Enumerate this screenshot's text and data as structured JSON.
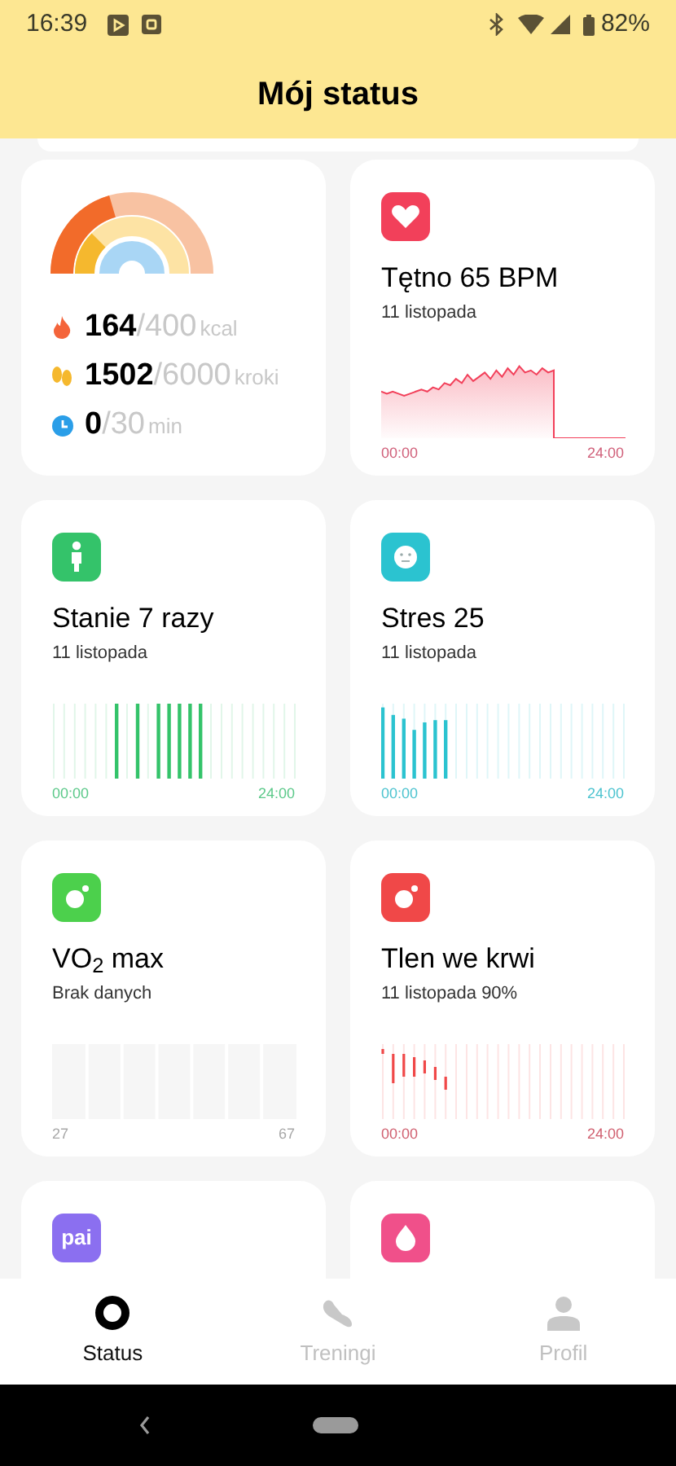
{
  "status_bar": {
    "time": "16:39",
    "battery": "82%"
  },
  "header": {
    "title": "Mój status"
  },
  "activity": {
    "stats": [
      {
        "kind": "calories",
        "value": "164",
        "goal": "/400",
        "unit": "kcal"
      },
      {
        "kind": "steps",
        "value": "1502",
        "goal": "/6000",
        "unit": "kroki"
      },
      {
        "kind": "minutes",
        "value": "0",
        "goal": "/30",
        "unit": "min"
      }
    ]
  },
  "cards": [
    {
      "kind": "heart",
      "color": "#f2405a",
      "title": "Tętno 65 BPM",
      "subtitle": "11 listopada",
      "axis_start": "00:00",
      "axis_end": "24:00"
    },
    {
      "kind": "stand",
      "color": "#34c36a",
      "title": "Stanie 7 razy",
      "subtitle": "11 listopada",
      "axis_start": "00:00",
      "axis_end": "24:00"
    },
    {
      "kind": "stress",
      "color": "#2bc3d0",
      "title": "Stres 25",
      "subtitle": "11 listopada",
      "axis_start": "00:00",
      "axis_end": "24:00"
    },
    {
      "kind": "vo2",
      "color": "#4cd04c",
      "title": "VO$_{2}$ max",
      "subtitle": "Brak danych",
      "axis_start": "27",
      "axis_end": "67"
    },
    {
      "kind": "oxygen",
      "color": "#f04848",
      "title": "Tlen we krwi",
      "subtitle": "11 listopada 90%",
      "axis_start": "00:00",
      "axis_end": "24:00"
    },
    {
      "kind": "pai",
      "color": "#8b6ff0",
      "icon_text": "pai"
    },
    {
      "kind": "cycle",
      "color": "#f0508a"
    }
  ],
  "nav": [
    {
      "kind": "status",
      "label": "Status",
      "selected": true
    },
    {
      "kind": "workouts",
      "label": "Treningi",
      "selected": false
    },
    {
      "kind": "profile",
      "label": "Profil",
      "selected": false
    }
  ]
}
